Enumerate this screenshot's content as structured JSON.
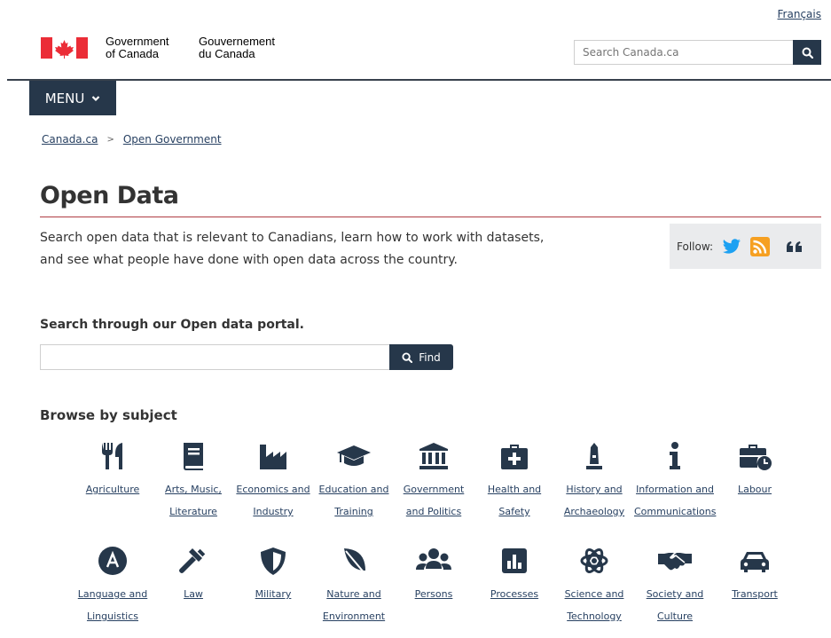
{
  "header": {
    "language_link": "Français",
    "signature_en_line1": "Government",
    "signature_en_line2": "of Canada",
    "signature_fr_line1": "Gouvernement",
    "signature_fr_line2": "du Canada",
    "search_placeholder": "Search Canada.ca",
    "menu_label": "MENU"
  },
  "breadcrumb": [
    "Canada.ca",
    "Open Government"
  ],
  "page": {
    "title": "Open Data",
    "intro": "Search open data that is relevant to Canadians, learn how to work with datasets, and see what people have done with open data across the country.",
    "follow_label": "Follow:",
    "portal_heading": "Search through our Open data portal.",
    "find_label": "Find",
    "browse_heading": "Browse by subject"
  },
  "subjects": [
    {
      "label": "Agriculture",
      "icon": "cutlery-icon"
    },
    {
      "label": "Arts, Music, Literature",
      "icon": "book-icon"
    },
    {
      "label": "Economics and Industry",
      "icon": "factory-icon"
    },
    {
      "label": "Education and Training",
      "icon": "graduation-cap-icon"
    },
    {
      "label": "Government and Politics",
      "icon": "government-building-icon"
    },
    {
      "label": "Health and Safety",
      "icon": "medical-kit-icon"
    },
    {
      "label": "History and Archaeology",
      "icon": "monument-icon"
    },
    {
      "label": "Information and Communications",
      "icon": "info-icon"
    },
    {
      "label": "Labour",
      "icon": "briefcase-clock-icon"
    },
    {
      "label": "Language and Linguistics",
      "icon": "letter-a-icon"
    },
    {
      "label": "Law",
      "icon": "gavel-icon"
    },
    {
      "label": "Military",
      "icon": "shield-icon"
    },
    {
      "label": "Nature and Environment",
      "icon": "leaf-icon"
    },
    {
      "label": "Persons",
      "icon": "people-icon"
    },
    {
      "label": "Processes",
      "icon": "bar-chart-icon"
    },
    {
      "label": "Science and Technology",
      "icon": "atom-icon"
    },
    {
      "label": "Society and Culture",
      "icon": "handshake-icon"
    },
    {
      "label": "Transport",
      "icon": "car-icon"
    }
  ],
  "colors": {
    "navy": "#26374a",
    "link": "#284162",
    "flag_red": "#eb2d37",
    "title_rule": "#af3c43",
    "twitter": "#1da1f2",
    "rss": "#f6a022"
  }
}
